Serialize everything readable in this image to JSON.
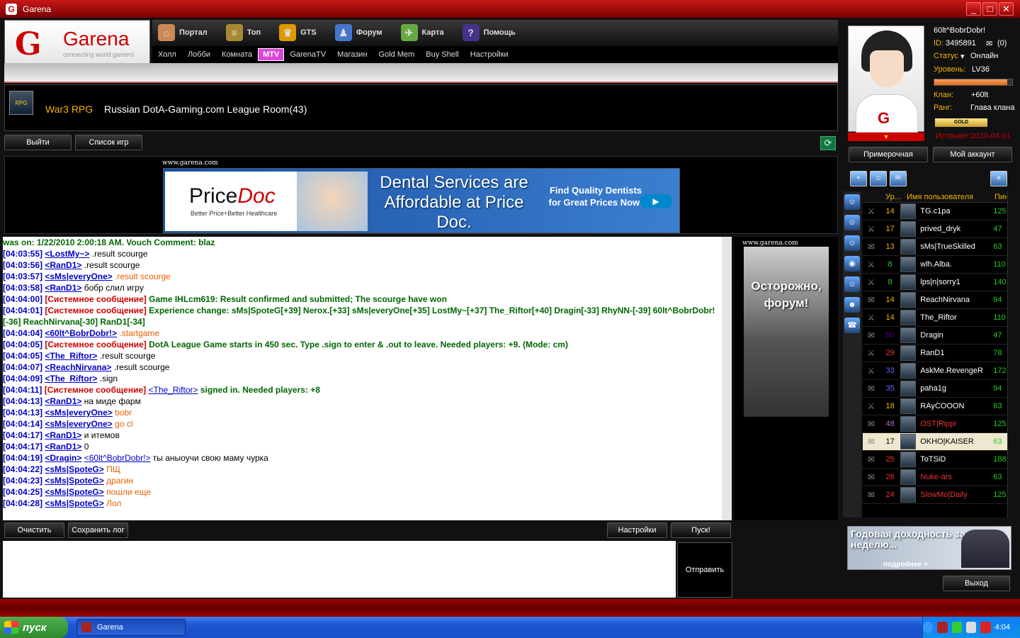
{
  "window": {
    "title": "Garena"
  },
  "logo": {
    "name": "Garena",
    "slogan": "connecting world gamers"
  },
  "topnav": [
    {
      "label": "Портал",
      "icon": "house-icon"
    },
    {
      "label": "Топ",
      "icon": "ladder-icon"
    },
    {
      "label": "GTS",
      "icon": "trophy-icon"
    },
    {
      "label": "Форум",
      "icon": "people-icon"
    },
    {
      "label": "Карта",
      "icon": "map-icon"
    },
    {
      "label": "Помощь",
      "icon": "help-icon"
    }
  ],
  "subnav": [
    "Холл",
    "Лобби",
    "Комната",
    "MTV",
    "GarenaTV",
    "Магазин",
    "Gold Mem",
    "Buy Shell",
    "Настройки"
  ],
  "room": {
    "game": "War3 RPG",
    "name": "Russian DotA-Gaming.com League Room(43)",
    "icon_text": "RPG"
  },
  "buttons": {
    "exit": "Выйти",
    "gamelist": "Список игр",
    "clear": "Очистить",
    "savelog": "Сохранить лог",
    "settings": "Настройки",
    "launch": "Пуск!",
    "send": "Отправить",
    "fitting": "Примерочная",
    "account": "Мой аккаунт",
    "logout": "Выход"
  },
  "ad_top": {
    "source": "www.garena.com",
    "brand_a": "Price",
    "brand_b": "Doc",
    "tagline": "Better Price+Better Healthcare",
    "headline": "Dental Services are Affordable at Price Doc.",
    "cta": "Find Quality Dentists for Great Prices Now!"
  },
  "ad_right": {
    "source": "www.garena.com",
    "text": "Осторожно, форум!"
  },
  "ad_bottom": {
    "text": "Годовая доходность за неделю...",
    "more": "подробнее >"
  },
  "chat": [
    {
      "ts": "",
      "nick": "",
      "msg": "was on: 1/22/2010 2:00:18 AM. Vouch Comment: blaz",
      "kind": "green"
    },
    {
      "ts": "[04:03:55]",
      "nick": "<LostMy~>",
      "msg": " .result scourge",
      "kind": "black"
    },
    {
      "ts": "[04:03:56]",
      "nick": "<RanD1>",
      "msg": " .result scourge",
      "kind": "black"
    },
    {
      "ts": "[04:03:57]",
      "nick": "<sMs|everyOne>",
      "msg": " .result scourge",
      "kind": "orange"
    },
    {
      "ts": "[04:03:58]",
      "nick": "<RanD1>",
      "msg": " бобр слил игру",
      "kind": "black"
    },
    {
      "ts": "[04:04:00]",
      "sys": "[Системное сообщение]",
      "msg": " Game IHLcm619: Result confirmed and submitted; The scourge have won",
      "kind": "sys"
    },
    {
      "ts": "[04:04:01]",
      "sys": "[Системное сообщение]",
      "msg": " Experience change: sMs|SpoteG[+39] Nerox.[+33] sMs|everyOne[+35] LostMy~[+37] The_Riftor[+40] Dragin[-33] RhyNN-[-39] 60lt^BobrDobr!",
      "kind": "sys"
    },
    {
      "ts": "",
      "nick": "",
      "msg": "[-36] ReachNirvana[-30] RanD1[-34]",
      "kind": "green"
    },
    {
      "ts": "[04:04:04]",
      "nick": "<60lt^BobrDobr!>",
      "msg": " .startgame",
      "kind": "orange"
    },
    {
      "ts": "[04:04:05]",
      "sys": "[Системное сообщение]",
      "msg": " DotA League Game starts in 450 sec. Type .sign to enter & .out to leave. Needed players: +9. (Mode: cm)",
      "kind": "sys"
    },
    {
      "ts": "[04:04:05]",
      "nick": "<The_Riftor>",
      "msg": " .result scourge",
      "kind": "black"
    },
    {
      "ts": "[04:04:07]",
      "nick": "<ReachNirvana>",
      "msg": " .result scourge",
      "kind": "black"
    },
    {
      "ts": "[04:04:09]",
      "nick": "<The_Riftor>",
      "msg": " .sign",
      "kind": "black"
    },
    {
      "ts": "[04:04:11]",
      "sys": "[Системное сообщение]",
      "nick": "<The_Riftor>",
      "msg": " signed in. Needed players: +8",
      "kind": "sysnick"
    },
    {
      "ts": "[04:04:13]",
      "nick": "<RanD1>",
      "msg": " на миде фарм",
      "kind": "black"
    },
    {
      "ts": "[04:04:13]",
      "nick": "<sMs|everyOne>",
      "msg": " bobr",
      "kind": "orange"
    },
    {
      "ts": "[04:04:14]",
      "nick": "<sMs|everyOne>",
      "msg": " go cl",
      "kind": "orange"
    },
    {
      "ts": "[04:04:17]",
      "nick": "<RanD1>",
      "msg": " и итемов",
      "kind": "black"
    },
    {
      "ts": "[04:04:17]",
      "nick": "<RanD1>",
      "msg": " 0",
      "kind": "black"
    },
    {
      "ts": "[04:04:19]",
      "nick": "<Dragin>",
      "nick2": "<60lt^BobrDobr!>",
      "msg": " ты аныоучи свою маму чурка",
      "kind": "black"
    },
    {
      "ts": "[04:04:22]",
      "nick": "<sMs|SpoteG>",
      "msg": " ПЩ",
      "kind": "orange"
    },
    {
      "ts": "[04:04:23]",
      "nick": "<sMs|SpoteG>",
      "msg": " драгин",
      "kind": "orange"
    },
    {
      "ts": "[04:04:25]",
      "nick": "<sMs|SpoteG>",
      "msg": " пошли еще",
      "kind": "orange"
    },
    {
      "ts": "[04:04:28]",
      "nick": "<sMs|SpoteG>",
      "msg": " Лол",
      "kind": "orange"
    }
  ],
  "profile": {
    "username": "60lt^BobrDobr!",
    "id_label": "ID:",
    "id": "3495891",
    "mail": "(0)",
    "status_label": "Статус",
    "status": "Онлайн",
    "level_label": "Уровень:",
    "level": "LV36",
    "level_progress": 0.94,
    "clan_label": "Клан:",
    "clan": "+60lt",
    "rank_label": "Ранг:",
    "rank": "Глава клана",
    "badge": "GOLD",
    "expires": "Истекает:2010-04-01"
  },
  "userlist_headers": {
    "level": "Ур...",
    "name": "Имя пользователя",
    "ping": "Пин"
  },
  "users": [
    {
      "lvl": "14",
      "name": "TG.c1pa",
      "ping": "125",
      "icon": "sword-icon",
      "lvlcolor": "#f2b400",
      "namecolor": "#fff"
    },
    {
      "lvl": "17",
      "name": "prived_dryk",
      "ping": "47",
      "icon": "sword-icon",
      "lvlcolor": "#f2b400",
      "namecolor": "#fff"
    },
    {
      "lvl": "13",
      "name": "sMs|TrueSkilled",
      "ping": "63",
      "icon": "chat-icon",
      "lvlcolor": "#f2b400",
      "namecolor": "#fff"
    },
    {
      "lvl": "8",
      "name": "wlh.Alba.",
      "ping": "110",
      "icon": "sword-icon",
      "lvlcolor": "#2c2",
      "namecolor": "#fff"
    },
    {
      "lvl": "8",
      "name": "lps|n|sorry1",
      "ping": "140",
      "icon": "sword-icon",
      "lvlcolor": "#2c2",
      "namecolor": "#fff"
    },
    {
      "lvl": "14",
      "name": "ReachNirvana",
      "ping": "94",
      "icon": "chat-icon",
      "lvlcolor": "#f2b400",
      "namecolor": "#fff"
    },
    {
      "lvl": "14",
      "name": "The_Riftor",
      "ping": "110",
      "icon": "sword-icon",
      "lvlcolor": "#f2b400",
      "namecolor": "#fff"
    },
    {
      "lvl": "50",
      "name": "Dragin",
      "ping": "47",
      "icon": "chat-icon",
      "lvlcolor": "#508",
      "namecolor": "#fff"
    },
    {
      "lvl": "29",
      "name": "RanD1",
      "ping": "78",
      "icon": "sword-icon",
      "lvlcolor": "#e33",
      "namecolor": "#fff"
    },
    {
      "lvl": "33",
      "name": "AskMe.RevengeR",
      "ping": "172",
      "icon": "sword-icon",
      "lvlcolor": "#66f",
      "namecolor": "#fff"
    },
    {
      "lvl": "35",
      "name": "paha1g",
      "ping": "94",
      "icon": "chat-icon",
      "lvlcolor": "#66f",
      "namecolor": "#fff"
    },
    {
      "lvl": "18",
      "name": "RAyCOOON",
      "ping": "63",
      "icon": "sword-icon",
      "lvlcolor": "#f2b400",
      "namecolor": "#fff"
    },
    {
      "lvl": "48",
      "name": "OST|Rippi",
      "ping": "125",
      "icon": "chat-icon",
      "lvlcolor": "#a6c",
      "namecolor": "#e33"
    },
    {
      "lvl": "17",
      "name": "OKHO|KAISER",
      "ping": "63",
      "icon": "chat-icon",
      "lvlcolor": "#000",
      "namecolor": "#000",
      "selected": true
    },
    {
      "lvl": "25",
      "name": "ToTSiD",
      "ping": "188",
      "icon": "chat-icon",
      "lvlcolor": "#e33",
      "namecolor": "#fff"
    },
    {
      "lvl": "26",
      "name": "Nuke-ars",
      "ping": "63",
      "icon": "chat-icon",
      "lvlcolor": "#e33",
      "namecolor": "#e33"
    },
    {
      "lvl": "24",
      "name": "SlowMo|Daily",
      "ping": "125",
      "icon": "chat-icon",
      "lvlcolor": "#e33",
      "namecolor": "#e33"
    }
  ],
  "taskbar": {
    "start": "пуск",
    "item": "Garena",
    "clock": "4:04"
  }
}
